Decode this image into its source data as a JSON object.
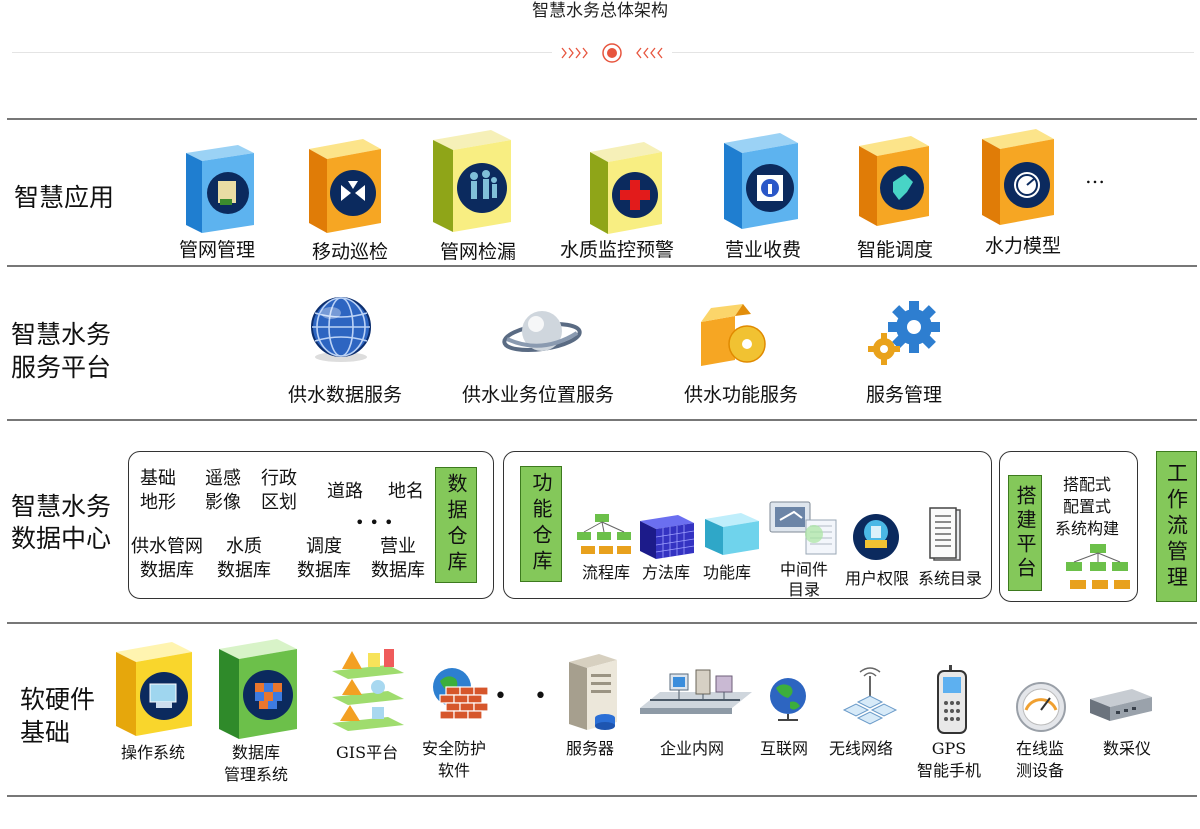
{
  "header": {
    "title": "智慧水务总体架构"
  },
  "colors": {
    "green_box": "#84c85a",
    "accent": "#e7553e",
    "rule": "#777777"
  },
  "rows": {
    "apps": {
      "label": "智慧应用",
      "items": [
        {
          "label": "管网管理",
          "icon": "box-blue-maintenance-icon"
        },
        {
          "label": "移动巡检",
          "icon": "box-orange-arrows-icon"
        },
        {
          "label": "管网检漏",
          "icon": "box-yellow-people-icon"
        },
        {
          "label": "水质监控预警",
          "icon": "box-yellow-red-cross-icon"
        },
        {
          "label": "营业收费",
          "icon": "box-blue-info-icon"
        },
        {
          "label": "智能调度",
          "icon": "box-orange-map-icon"
        },
        {
          "label": "水力模型",
          "icon": "box-orange-gauge-icon"
        }
      ],
      "more": "…"
    },
    "service": {
      "label_line1": "智慧水务",
      "label_line2": "服务平台",
      "items": [
        {
          "label": "供水数据服务",
          "icon": "globe-icon"
        },
        {
          "label": "供水业务位置服务",
          "icon": "planet-icon"
        },
        {
          "label": "供水功能服务",
          "icon": "box-cd-icon"
        },
        {
          "label": "服务管理",
          "icon": "gears-icon"
        }
      ]
    },
    "data_center": {
      "label_line1": "智慧水务",
      "label_line2": "数据中心",
      "warehouse": {
        "items": [
          {
            "line1": "基础",
            "line2": "地形"
          },
          {
            "line1": "遥感",
            "line2": "影像"
          },
          {
            "line1": "行政",
            "line2": "区划"
          },
          {
            "line1": "道路",
            "line2": ""
          },
          {
            "line1": "地名",
            "line2": ""
          },
          {
            "line1": "供水管网",
            "line2": "数据库"
          },
          {
            "line1": "水质",
            "line2": "数据库"
          },
          {
            "line1": "调度",
            "line2": "数据库"
          },
          {
            "line1": "营业",
            "line2": "数据库"
          }
        ],
        "ellipsis": "• • •",
        "title": "数据仓库"
      },
      "function_warehouse": {
        "title": "功能仓库",
        "items": [
          {
            "label": "流程库",
            "icon": "flow-blocks-icon"
          },
          {
            "label": "方法库",
            "icon": "cube-grid-icon"
          },
          {
            "label": "功能库",
            "icon": "cube-icon"
          },
          {
            "label_line1": "中间件",
            "label_line2": "目录",
            "icon": "middleware-icon"
          },
          {
            "label": "用户权限",
            "icon": "user-auth-icon"
          },
          {
            "label": "系统目录",
            "icon": "document-icon"
          }
        ]
      },
      "build_platform": {
        "title": "搭建平台",
        "text_line1": "搭配式",
        "text_line2": "配置式",
        "text_line3": "系统构建"
      },
      "workflow": {
        "title": "工作流管理"
      }
    },
    "infra": {
      "label_line1": "软硬件",
      "label_line2": "基础",
      "items": [
        {
          "label": "操作系统",
          "icon": "box-yellow-monitor-icon"
        },
        {
          "label_line1": "数据库",
          "label_line2": "管理系统",
          "icon": "box-green-cubes-icon"
        },
        {
          "label": "GIS平台",
          "icon": "gis-layers-icon"
        },
        {
          "label_line1": "安全防护",
          "label_line2": "软件",
          "icon": "firewall-icon"
        },
        {
          "label": "服务器",
          "icon": "server-icon"
        },
        {
          "label": "企业内网",
          "icon": "lan-icon"
        },
        {
          "label": "互联网",
          "icon": "internet-globe-icon"
        },
        {
          "label": "无线网络",
          "icon": "wireless-icon"
        },
        {
          "label_line1": "GPS",
          "label_line2": "智能手机",
          "icon": "mobile-phone-icon"
        },
        {
          "label_line1": "在线监",
          "label_line2": "测设备",
          "icon": "meter-icon"
        },
        {
          "label": "数采仪",
          "icon": "device-box-icon"
        }
      ],
      "ellipsis": "• • •"
    }
  }
}
